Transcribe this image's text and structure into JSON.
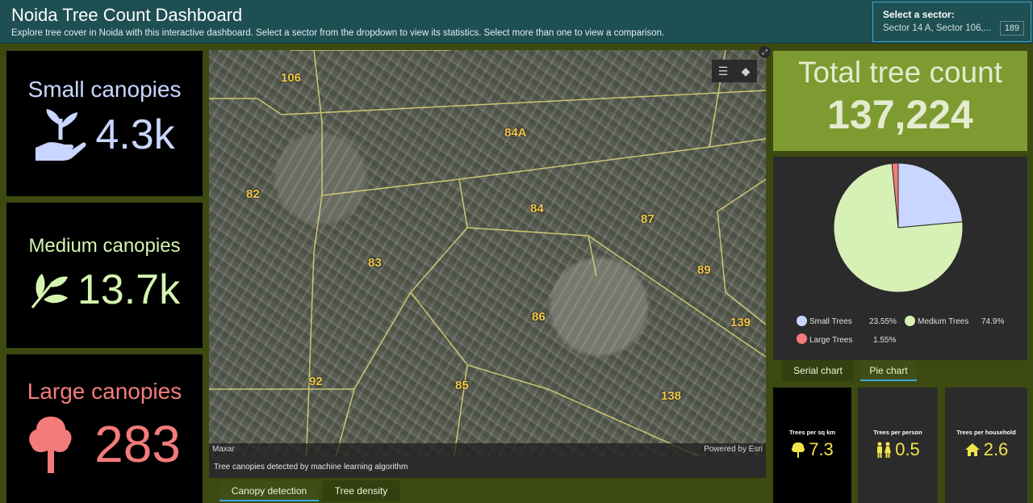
{
  "header": {
    "title": "Noida Tree Count Dashboard",
    "subtitle": "Explore tree cover in Noida with this interactive dashboard. Select a sector from the dropdown to view its statistics. Select more than one to view a comparison."
  },
  "selector": {
    "label": "Select a sector:",
    "value": "Sector 14 A, Sector 106,...",
    "count": "189"
  },
  "canopies": {
    "small": {
      "label": "Small canopies",
      "value": "4.3k",
      "icon": "hand-sprout-icon",
      "color": "#c9d6ff"
    },
    "medium": {
      "label": "Medium canopies",
      "value": "13.7k",
      "icon": "leaves-icon",
      "color": "#d4f5b0"
    },
    "large": {
      "label": "Large canopies",
      "value": "283",
      "icon": "tree-icon",
      "color": "#f47b7b"
    }
  },
  "map": {
    "sectors": [
      "106",
      "84A",
      "82",
      "84",
      "87",
      "83",
      "89",
      "86",
      "139",
      "92",
      "85",
      "138"
    ],
    "attribution_left": "Maxar",
    "attribution_right": "Powered by Esri",
    "caption": "Tree canopies detected by machine learning algorithm"
  },
  "map_tabs": {
    "canopy_detection": "Canopy detection",
    "tree_density": "Tree density"
  },
  "total": {
    "label": "Total tree count",
    "value": "137,224"
  },
  "chart_data": {
    "type": "pie",
    "slices": [
      {
        "name": "Small Trees",
        "percent": 23.55,
        "label": "23.55%",
        "color": "#c9d6ff"
      },
      {
        "name": "Medium Trees",
        "percent": 74.9,
        "label": "74.9%",
        "color": "#d7f0b6"
      },
      {
        "name": "Large Trees",
        "percent": 1.55,
        "label": "1.55%",
        "color": "#f47b7b"
      }
    ]
  },
  "chart_tabs": {
    "serial": "Serial chart",
    "pie": "Pie chart"
  },
  "metrics": {
    "per_sq_km": {
      "label": "Trees per sq km",
      "value": "7.3",
      "icon": "tree-icon"
    },
    "per_person": {
      "label": "Trees per person",
      "value": "0.5",
      "icon": "people-icon"
    },
    "per_household": {
      "label": "Trees per household",
      "value": "2.6",
      "icon": "house-icon"
    }
  }
}
